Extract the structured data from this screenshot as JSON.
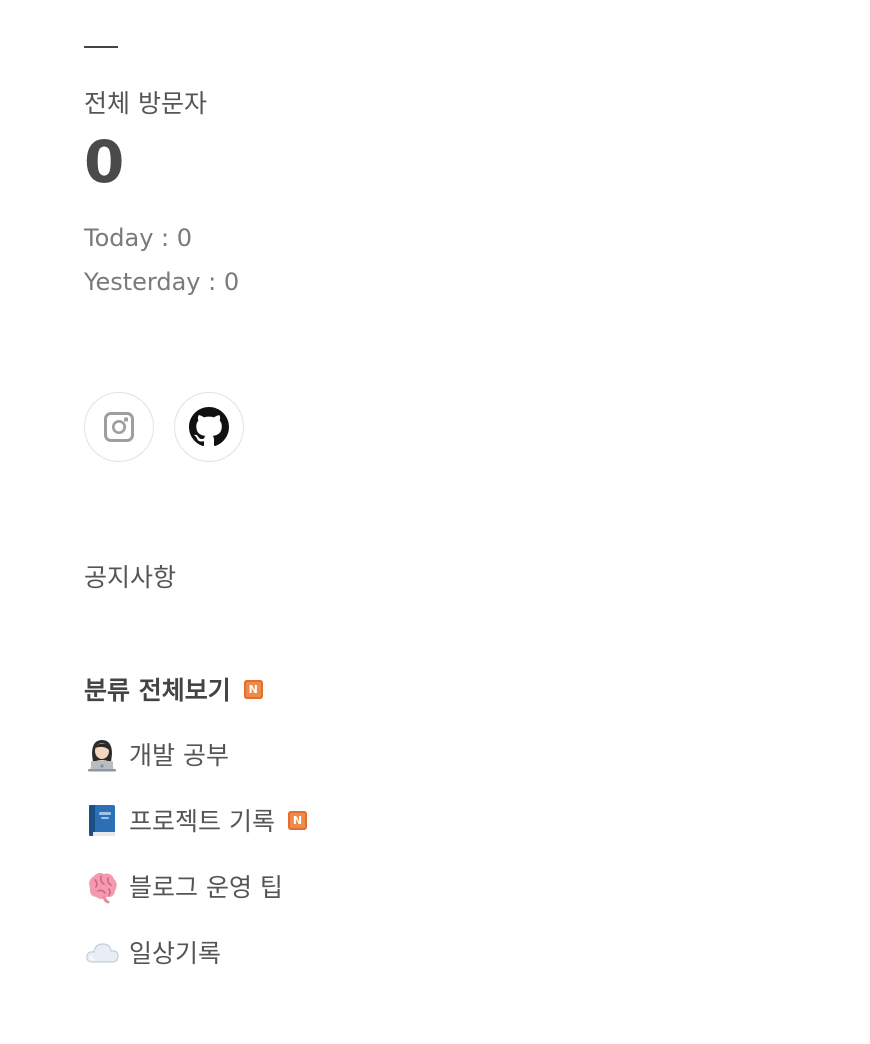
{
  "visitors": {
    "title": "전체 방문자",
    "total": "0",
    "today": "Today : 0",
    "yesterday": "Yesterday : 0"
  },
  "social": {
    "items": [
      {
        "icon": "instagram-icon"
      },
      {
        "icon": "github-icon"
      }
    ]
  },
  "notice": {
    "label": "공지사항"
  },
  "categories": {
    "all_label": "분류 전체보기",
    "new_badge": "N",
    "items": [
      {
        "emoji": "person-laptop-emoji",
        "label": "개발 공부",
        "has_new": false
      },
      {
        "emoji": "blue-book-emoji",
        "label": "프로젝트 기록",
        "has_new": true
      },
      {
        "emoji": "brain-emoji",
        "label": "블로그 운영 팁",
        "has_new": false
      },
      {
        "emoji": "cloud-emoji",
        "label": "일상기록",
        "has_new": false
      }
    ]
  },
  "colors": {
    "text": "#555555",
    "muted": "#7a7a7a",
    "badge": "#f08a4b"
  }
}
